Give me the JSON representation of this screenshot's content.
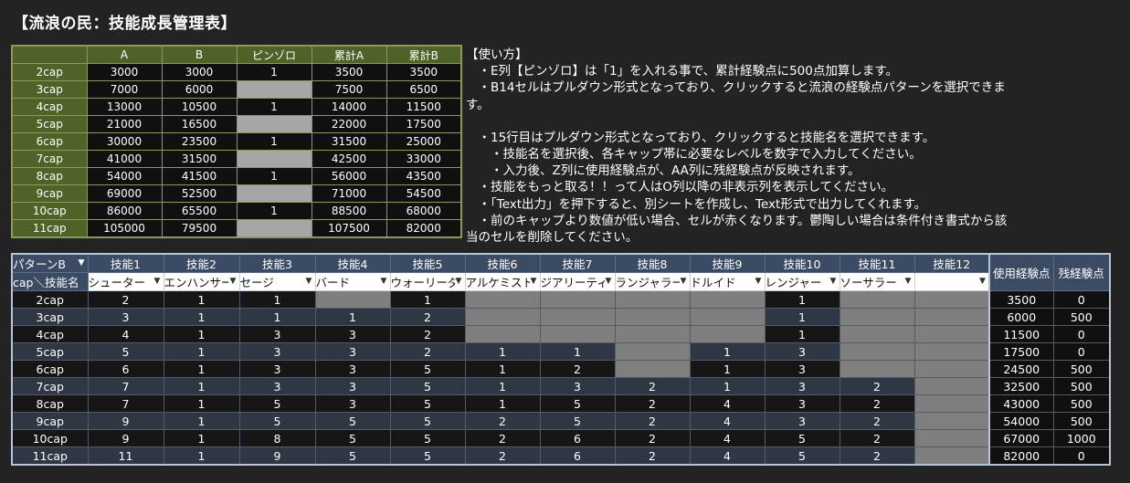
{
  "title": "【流浪の民：技能成長管理表】",
  "cap_table": {
    "headers": [
      "",
      "A",
      "B",
      "ピンゾロ",
      "累計A",
      "累計B"
    ],
    "rows": [
      [
        "2cap",
        "3000",
        "3000",
        "1",
        "3500",
        "3500"
      ],
      [
        "3cap",
        "7000",
        "6000",
        "",
        "7500",
        "6500"
      ],
      [
        "4cap",
        "13000",
        "10500",
        "1",
        "14000",
        "11500"
      ],
      [
        "5cap",
        "21000",
        "16500",
        "",
        "22000",
        "17500"
      ],
      [
        "6cap",
        "30000",
        "23500",
        "1",
        "31500",
        "25000"
      ],
      [
        "7cap",
        "41000",
        "31500",
        "",
        "42500",
        "33000"
      ],
      [
        "8cap",
        "54000",
        "41500",
        "1",
        "56000",
        "43500"
      ],
      [
        "9cap",
        "69000",
        "52500",
        "",
        "71000",
        "54500"
      ],
      [
        "10cap",
        "86000",
        "65500",
        "1",
        "88500",
        "68000"
      ],
      [
        "11cap",
        "105000",
        "79500",
        "",
        "107500",
        "82000"
      ]
    ]
  },
  "usage": {
    "lines": [
      "【使い方】",
      "　・E列【ピンゾロ】は「1」を入れる事で、累計経験点に500点加算します。",
      "　・B14セルはプルダウン形式となっており、クリックすると流浪の経験点パターンを選択できま",
      "す。",
      "",
      "　・15行目はプルダウン形式となっており、クリックすると技能名を選択できます。",
      "　　・技能名を選択後、各キャップ帯に必要なレベルを数字で入力してください。",
      "　　・入力後、Z列に使用経験点が、AA列に残経験点が反映されます。",
      "　・技能をもっと取る！！って人はO列以降の非表示列を表示してください。",
      "　・「Text出力」を押下すると、別シートを作成し、Text形式で出力してくれます。",
      "　・前のキャップより数値が低い場合、セルが赤くなります。鬱陶しい場合は条件付き書式から該",
      "当のセルを削除してください。"
    ]
  },
  "skill_table": {
    "pattern_select": "パターンB",
    "headers": [
      "技能1",
      "技能2",
      "技能3",
      "技能4",
      "技能5",
      "技能6",
      "技能7",
      "技能8",
      "技能9",
      "技能10",
      "技能11",
      "技能12"
    ],
    "corner_label": "cap＼技能名",
    "skill_names": [
      "シューター",
      "エンハンサー",
      "セージ",
      "バード",
      "ウォーリーダー",
      "アルケミスト",
      "ジアリーティ",
      "ランジャラー",
      "ドルイド",
      "レンジャー",
      "ソーサラー",
      ""
    ],
    "used_exp_header": "使用経験点",
    "remaining_exp_header": "残経験点",
    "rows": [
      {
        "cap": "2cap",
        "levels": [
          "2",
          "1",
          "1",
          "",
          "1",
          "",
          "",
          "",
          "",
          "1",
          "",
          ""
        ],
        "used": "3500",
        "remaining": "0"
      },
      {
        "cap": "3cap",
        "levels": [
          "3",
          "1",
          "1",
          "1",
          "2",
          "",
          "",
          "",
          "",
          "1",
          "",
          ""
        ],
        "used": "6000",
        "remaining": "500"
      },
      {
        "cap": "4cap",
        "levels": [
          "4",
          "1",
          "3",
          "3",
          "2",
          "",
          "",
          "",
          "",
          "1",
          "",
          ""
        ],
        "used": "11500",
        "remaining": "0"
      },
      {
        "cap": "5cap",
        "levels": [
          "5",
          "1",
          "3",
          "3",
          "2",
          "1",
          "1",
          "",
          "1",
          "3",
          "",
          ""
        ],
        "used": "17500",
        "remaining": "0"
      },
      {
        "cap": "6cap",
        "levels": [
          "6",
          "1",
          "3",
          "3",
          "5",
          "1",
          "2",
          "",
          "1",
          "3",
          "",
          ""
        ],
        "used": "24500",
        "remaining": "500"
      },
      {
        "cap": "7cap",
        "levels": [
          "7",
          "1",
          "3",
          "3",
          "5",
          "1",
          "3",
          "2",
          "1",
          "3",
          "2",
          ""
        ],
        "used": "32500",
        "remaining": "500"
      },
      {
        "cap": "8cap",
        "levels": [
          "7",
          "1",
          "5",
          "3",
          "5",
          "1",
          "5",
          "2",
          "4",
          "3",
          "2",
          ""
        ],
        "used": "43000",
        "remaining": "500"
      },
      {
        "cap": "9cap",
        "levels": [
          "9",
          "1",
          "5",
          "5",
          "5",
          "2",
          "5",
          "2",
          "4",
          "3",
          "2",
          ""
        ],
        "used": "54000",
        "remaining": "500"
      },
      {
        "cap": "10cap",
        "levels": [
          "9",
          "1",
          "8",
          "5",
          "5",
          "2",
          "6",
          "2",
          "4",
          "5",
          "2",
          ""
        ],
        "used": "67000",
        "remaining": "1000"
      },
      {
        "cap": "11cap",
        "levels": [
          "11",
          "1",
          "9",
          "5",
          "5",
          "2",
          "6",
          "2",
          "4",
          "5",
          "2",
          ""
        ],
        "used": "82000",
        "remaining": "0"
      }
    ]
  },
  "colors": {
    "background": "#232323",
    "cap_header": "#4f6228",
    "cap_border": "#8a9a5b",
    "skill_header": "#3a4b63",
    "blank_cell_grey": "#7f7f7f",
    "pinzoro_grey": "#a6a6a6"
  },
  "icons": [
    "dropdown-arrow-icon"
  ]
}
